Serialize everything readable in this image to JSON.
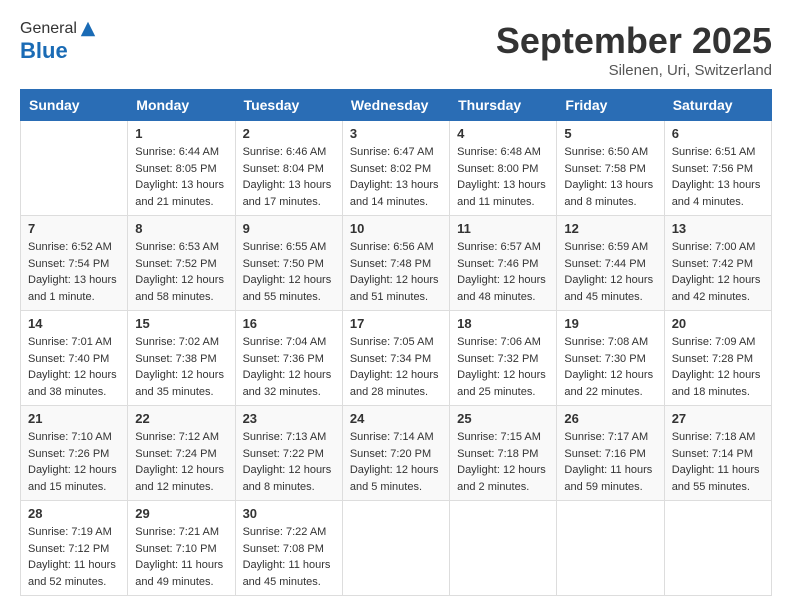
{
  "header": {
    "logo_line1": "General",
    "logo_line2": "Blue",
    "month": "September 2025",
    "location": "Silenen, Uri, Switzerland"
  },
  "days_of_week": [
    "Sunday",
    "Monday",
    "Tuesday",
    "Wednesday",
    "Thursday",
    "Friday",
    "Saturday"
  ],
  "weeks": [
    [
      {
        "day": "",
        "info": ""
      },
      {
        "day": "1",
        "info": "Sunrise: 6:44 AM\nSunset: 8:05 PM\nDaylight: 13 hours and 21 minutes."
      },
      {
        "day": "2",
        "info": "Sunrise: 6:46 AM\nSunset: 8:04 PM\nDaylight: 13 hours and 17 minutes."
      },
      {
        "day": "3",
        "info": "Sunrise: 6:47 AM\nSunset: 8:02 PM\nDaylight: 13 hours and 14 minutes."
      },
      {
        "day": "4",
        "info": "Sunrise: 6:48 AM\nSunset: 8:00 PM\nDaylight: 13 hours and 11 minutes."
      },
      {
        "day": "5",
        "info": "Sunrise: 6:50 AM\nSunset: 7:58 PM\nDaylight: 13 hours and 8 minutes."
      },
      {
        "day": "6",
        "info": "Sunrise: 6:51 AM\nSunset: 7:56 PM\nDaylight: 13 hours and 4 minutes."
      }
    ],
    [
      {
        "day": "7",
        "info": "Sunrise: 6:52 AM\nSunset: 7:54 PM\nDaylight: 13 hours and 1 minute."
      },
      {
        "day": "8",
        "info": "Sunrise: 6:53 AM\nSunset: 7:52 PM\nDaylight: 12 hours and 58 minutes."
      },
      {
        "day": "9",
        "info": "Sunrise: 6:55 AM\nSunset: 7:50 PM\nDaylight: 12 hours and 55 minutes."
      },
      {
        "day": "10",
        "info": "Sunrise: 6:56 AM\nSunset: 7:48 PM\nDaylight: 12 hours and 51 minutes."
      },
      {
        "day": "11",
        "info": "Sunrise: 6:57 AM\nSunset: 7:46 PM\nDaylight: 12 hours and 48 minutes."
      },
      {
        "day": "12",
        "info": "Sunrise: 6:59 AM\nSunset: 7:44 PM\nDaylight: 12 hours and 45 minutes."
      },
      {
        "day": "13",
        "info": "Sunrise: 7:00 AM\nSunset: 7:42 PM\nDaylight: 12 hours and 42 minutes."
      }
    ],
    [
      {
        "day": "14",
        "info": "Sunrise: 7:01 AM\nSunset: 7:40 PM\nDaylight: 12 hours and 38 minutes."
      },
      {
        "day": "15",
        "info": "Sunrise: 7:02 AM\nSunset: 7:38 PM\nDaylight: 12 hours and 35 minutes."
      },
      {
        "day": "16",
        "info": "Sunrise: 7:04 AM\nSunset: 7:36 PM\nDaylight: 12 hours and 32 minutes."
      },
      {
        "day": "17",
        "info": "Sunrise: 7:05 AM\nSunset: 7:34 PM\nDaylight: 12 hours and 28 minutes."
      },
      {
        "day": "18",
        "info": "Sunrise: 7:06 AM\nSunset: 7:32 PM\nDaylight: 12 hours and 25 minutes."
      },
      {
        "day": "19",
        "info": "Sunrise: 7:08 AM\nSunset: 7:30 PM\nDaylight: 12 hours and 22 minutes."
      },
      {
        "day": "20",
        "info": "Sunrise: 7:09 AM\nSunset: 7:28 PM\nDaylight: 12 hours and 18 minutes."
      }
    ],
    [
      {
        "day": "21",
        "info": "Sunrise: 7:10 AM\nSunset: 7:26 PM\nDaylight: 12 hours and 15 minutes."
      },
      {
        "day": "22",
        "info": "Sunrise: 7:12 AM\nSunset: 7:24 PM\nDaylight: 12 hours and 12 minutes."
      },
      {
        "day": "23",
        "info": "Sunrise: 7:13 AM\nSunset: 7:22 PM\nDaylight: 12 hours and 8 minutes."
      },
      {
        "day": "24",
        "info": "Sunrise: 7:14 AM\nSunset: 7:20 PM\nDaylight: 12 hours and 5 minutes."
      },
      {
        "day": "25",
        "info": "Sunrise: 7:15 AM\nSunset: 7:18 PM\nDaylight: 12 hours and 2 minutes."
      },
      {
        "day": "26",
        "info": "Sunrise: 7:17 AM\nSunset: 7:16 PM\nDaylight: 11 hours and 59 minutes."
      },
      {
        "day": "27",
        "info": "Sunrise: 7:18 AM\nSunset: 7:14 PM\nDaylight: 11 hours and 55 minutes."
      }
    ],
    [
      {
        "day": "28",
        "info": "Sunrise: 7:19 AM\nSunset: 7:12 PM\nDaylight: 11 hours and 52 minutes."
      },
      {
        "day": "29",
        "info": "Sunrise: 7:21 AM\nSunset: 7:10 PM\nDaylight: 11 hours and 49 minutes."
      },
      {
        "day": "30",
        "info": "Sunrise: 7:22 AM\nSunset: 7:08 PM\nDaylight: 11 hours and 45 minutes."
      },
      {
        "day": "",
        "info": ""
      },
      {
        "day": "",
        "info": ""
      },
      {
        "day": "",
        "info": ""
      },
      {
        "day": "",
        "info": ""
      }
    ]
  ]
}
